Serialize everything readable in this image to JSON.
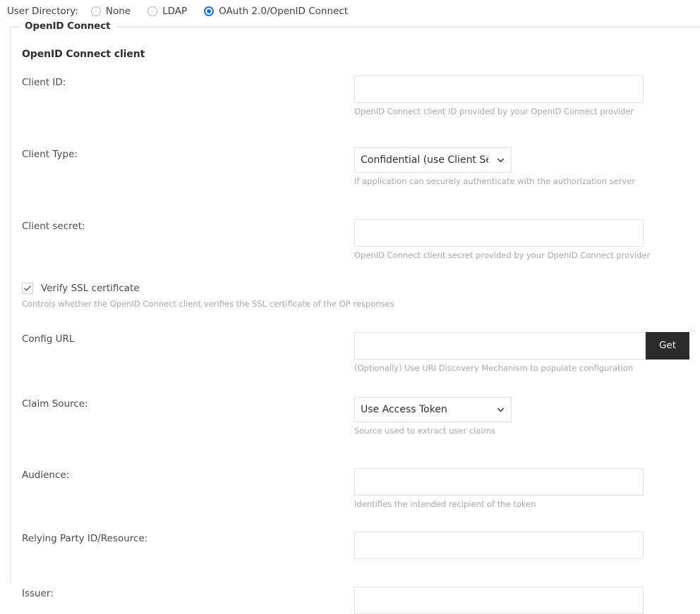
{
  "directory": {
    "label": "User Directory:",
    "options": [
      {
        "label": "None",
        "selected": false
      },
      {
        "label": "LDAP",
        "selected": false
      },
      {
        "label": "OAuth 2.0/OpenID Connect",
        "selected": true
      }
    ],
    "accent_color": "#1a73e8"
  },
  "panel": {
    "legend": "OpenID Connect",
    "section_title": "OpenID Connect client"
  },
  "fields": {
    "client_id": {
      "label": "Client ID:",
      "value": "",
      "placeholder": "",
      "help": "OpenID Connect client ID provided by your OpenID Connect provider"
    },
    "client_type": {
      "label": "Client Type:",
      "value": "Confidential (use Client Secret)",
      "options": [
        "Confidential (use Client Secret)"
      ],
      "help": "If application can securely authenticate with the authorization server",
      "chevron_icon": "chevron-down-icon"
    },
    "client_secret": {
      "label": "Client secret:",
      "value": "",
      "placeholder": "",
      "help": "OpenID Connect client secret provided by your OpenID Connect provider"
    },
    "verify_ssl": {
      "label": "Verify SSL certificate",
      "checked": true,
      "check_icon": "checkmark-icon",
      "help": "Controls whether the OpenID Connect client verifies the SSL certificate of the OP responses"
    },
    "config_url": {
      "label": "Config URL",
      "value": "",
      "placeholder": "",
      "button_label": "Get",
      "button_color": "#2b2b2b",
      "help": "(Optionally) Use URI Discovery Mechanism to populate configuration"
    },
    "claim_source": {
      "label": "Claim Source:",
      "value": "Use Access Token",
      "options": [
        "Use Access Token"
      ],
      "help": "Source used to extract user claims",
      "chevron_icon": "chevron-down-icon"
    },
    "audience": {
      "label": "Audience:",
      "value": "",
      "placeholder": "",
      "help": "Identifies the intended recipient of the token"
    },
    "relying_party": {
      "label": "Relying Party ID/Resource:",
      "value": "",
      "placeholder": "",
      "help": ""
    },
    "issuer": {
      "label": "Issuer:",
      "value": "",
      "placeholder": "",
      "help": ""
    }
  }
}
